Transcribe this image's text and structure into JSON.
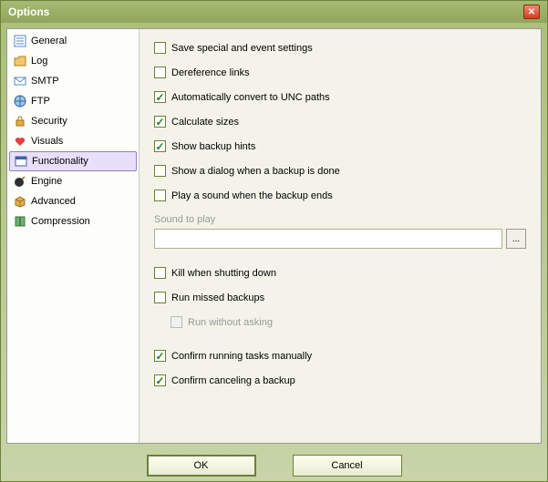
{
  "window": {
    "title": "Options"
  },
  "sidebar": {
    "items": [
      {
        "label": "General",
        "icon": "list-icon"
      },
      {
        "label": "Log",
        "icon": "folder-icon"
      },
      {
        "label": "SMTP",
        "icon": "mail-icon"
      },
      {
        "label": "FTP",
        "icon": "globe-icon"
      },
      {
        "label": "Security",
        "icon": "lock-icon"
      },
      {
        "label": "Visuals",
        "icon": "heart-icon"
      },
      {
        "label": "Functionality",
        "icon": "window-icon"
      },
      {
        "label": "Engine",
        "icon": "bomb-icon"
      },
      {
        "label": "Advanced",
        "icon": "box-icon"
      },
      {
        "label": "Compression",
        "icon": "archive-icon"
      }
    ],
    "selected_index": 6
  },
  "options": {
    "save_special": {
      "label": "Save special and event settings",
      "checked": false
    },
    "dereference": {
      "label": "Dereference links",
      "checked": false
    },
    "unc": {
      "label": "Automatically convert to UNC paths",
      "checked": true
    },
    "calc_sizes": {
      "label": "Calculate sizes",
      "checked": true
    },
    "hints": {
      "label": "Show backup hints",
      "checked": true
    },
    "dialog_done": {
      "label": "Show a dialog when a backup is done",
      "checked": false
    },
    "play_sound": {
      "label": "Play a sound when the backup ends",
      "checked": false
    },
    "sound_label": "Sound to play",
    "sound_value": "",
    "kill_shutdown": {
      "label": "Kill when shutting down",
      "checked": false
    },
    "run_missed": {
      "label": "Run missed backups",
      "checked": false
    },
    "run_without_asking": {
      "label": "Run without asking",
      "checked": false,
      "disabled": true
    },
    "confirm_running": {
      "label": "Confirm running tasks manually",
      "checked": true
    },
    "confirm_cancel": {
      "label": "Confirm canceling a backup",
      "checked": true
    }
  },
  "buttons": {
    "ok": "OK",
    "cancel": "Cancel",
    "browse": "..."
  }
}
